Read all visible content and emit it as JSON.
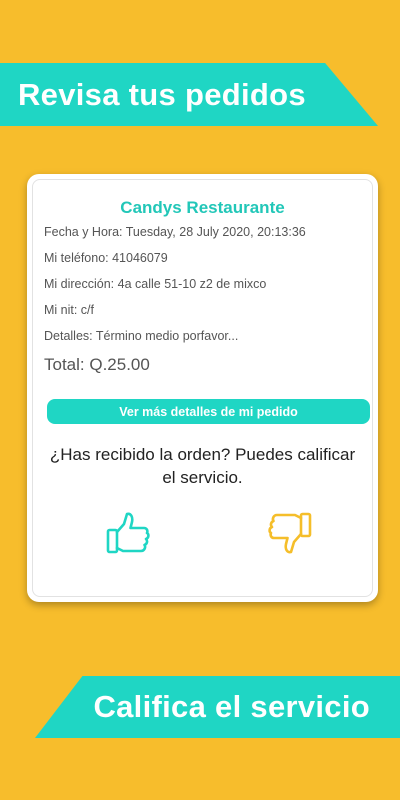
{
  "banners": {
    "top": "Revisa tus pedidos",
    "bottom": "Califica el servicio"
  },
  "order": {
    "restaurant": "Candys Restaurante",
    "fecha": "Fecha y Hora: Tuesday, 28 July 2020, 20:13:36",
    "telefono": "Mi teléfono: 41046079",
    "direccion": "Mi dirección: 4a calle 51-10 z2 de mixco",
    "nit": "Mi nit: c/f",
    "detalles": "Detalles: Término medio porfavor...",
    "total": "Total: Q.25.00",
    "details_button": "Ver más detalles de mi pedido"
  },
  "rating": {
    "question": "¿Has recibido la orden? Puedes calificar el servicio.",
    "like_icon": "thumbs-up-icon",
    "dislike_icon": "thumbs-down-icon"
  },
  "colors": {
    "background": "#F7BD2C",
    "accent": "#1FD6C4",
    "restaurant_text": "#22C7B8",
    "dislike": "#F5BE2A"
  }
}
